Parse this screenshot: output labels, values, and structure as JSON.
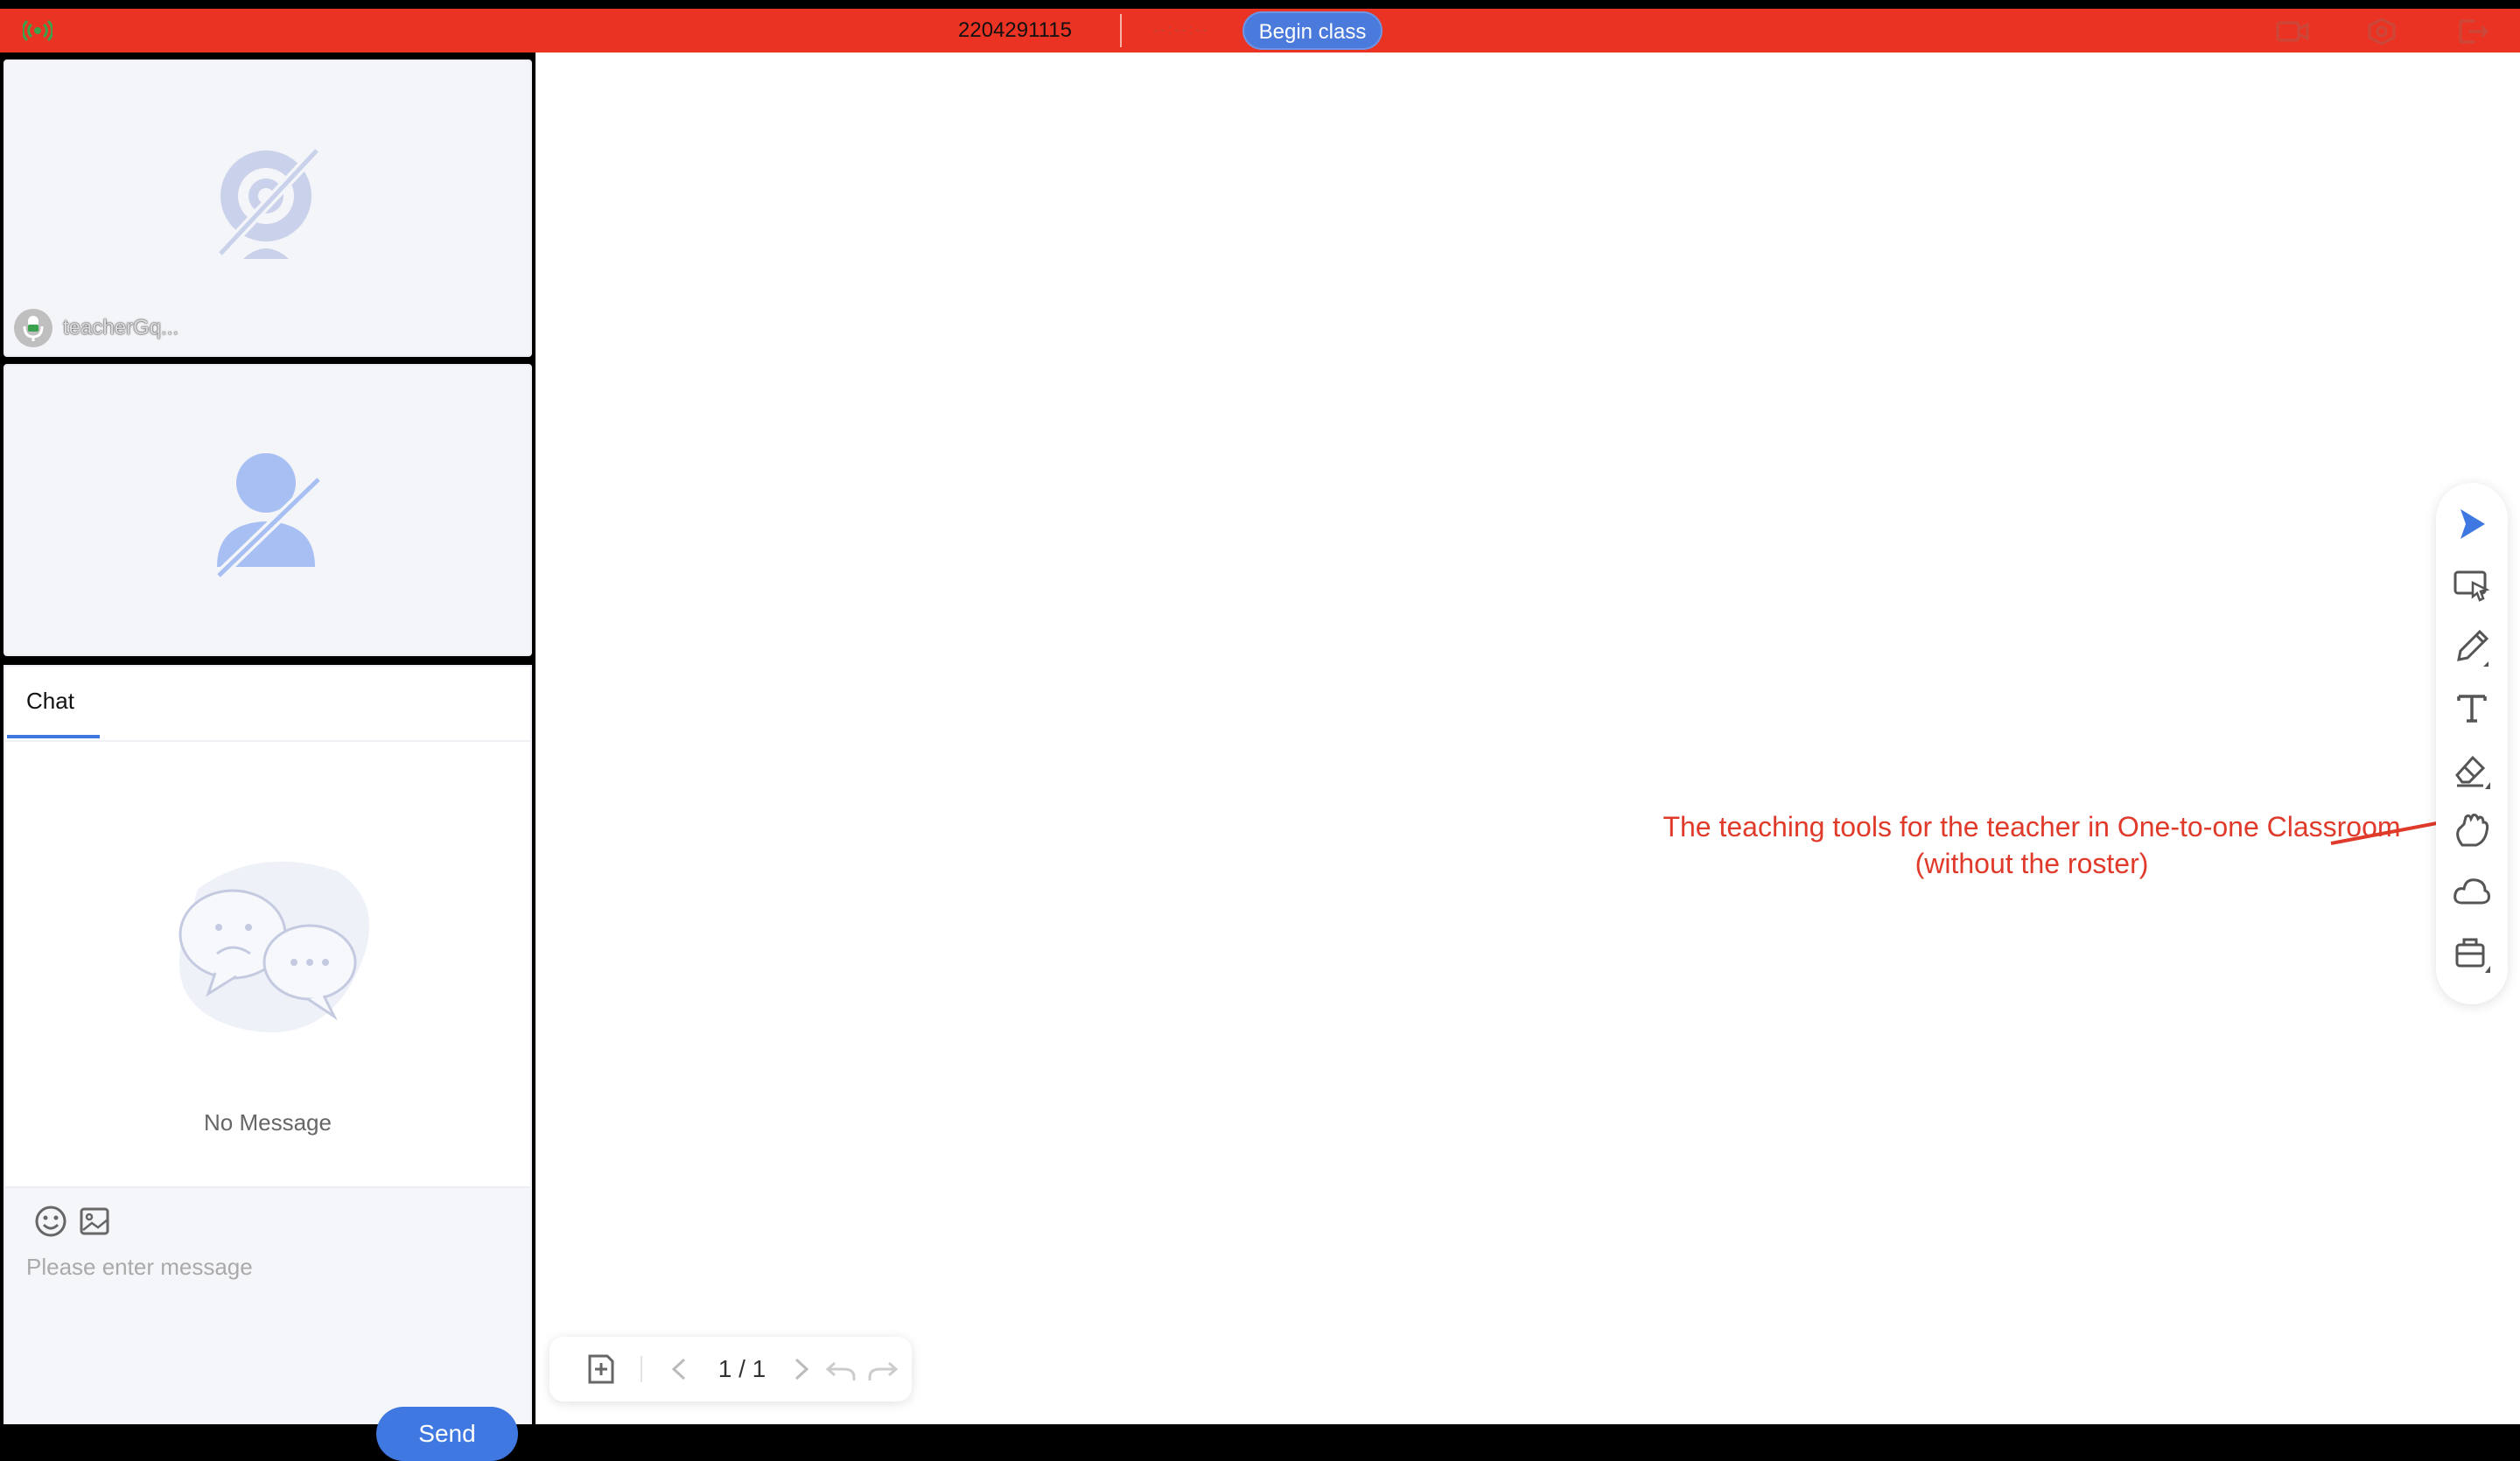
{
  "topbar": {
    "room_id": "2204291115",
    "timer": "--:--:--",
    "begin_label": "Begin class"
  },
  "teacher_tile": {
    "name": "teacherGq..."
  },
  "chat": {
    "tab_label": "Chat",
    "empty_text": "No Message",
    "input_placeholder": "Please enter message",
    "send_label": "Send"
  },
  "whiteboard": {
    "annotation_line1": "The teaching tools for the teacher in One-to-one Classroom",
    "annotation_line2": "(without the roster)",
    "page_indicator": "1 / 1"
  },
  "toolbar_tools": [
    "select-arrow-icon",
    "laser-pointer-icon",
    "pen-icon",
    "text-icon",
    "eraser-icon",
    "hand-icon",
    "cloud-icon",
    "toolbox-icon"
  ],
  "colors": {
    "topbar": "#ea3323",
    "accent": "#3f78e0",
    "annotation": "#e03a2b",
    "panel_bg": "#f4f5f9"
  }
}
